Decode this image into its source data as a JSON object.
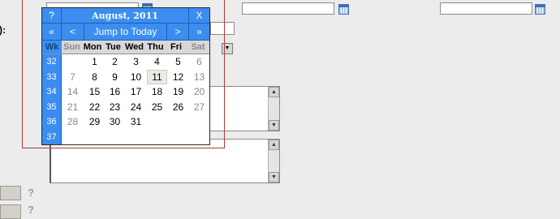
{
  "form": {
    "row_label_fragment": "):"
  },
  "calendar": {
    "help_label": "?",
    "title": "August, 2011",
    "close_label": "X",
    "prev_year_label": "«",
    "prev_month_label": "<",
    "today_label": "Jump to Today",
    "next_month_label": ">",
    "next_year_label": "»",
    "week_header": "Wk",
    "day_names": [
      "Sun",
      "Mon",
      "Tue",
      "Wed",
      "Thu",
      "Fri",
      "Sat"
    ],
    "weeks": [
      {
        "wk": "32",
        "days": [
          "",
          "1",
          "2",
          "3",
          "4",
          "5",
          "6"
        ]
      },
      {
        "wk": "33",
        "days": [
          "7",
          "8",
          "9",
          "10",
          "11",
          "12",
          "13"
        ]
      },
      {
        "wk": "34",
        "days": [
          "14",
          "15",
          "16",
          "17",
          "18",
          "19",
          "20"
        ]
      },
      {
        "wk": "35",
        "days": [
          "21",
          "22",
          "23",
          "24",
          "25",
          "26",
          "27"
        ]
      },
      {
        "wk": "36",
        "days": [
          "28",
          "29",
          "30",
          "31",
          "",
          "",
          ""
        ]
      },
      {
        "wk": "37",
        "days": [
          "",
          "",
          "",
          "",
          "",
          "",
          ""
        ]
      }
    ],
    "today": "11",
    "colors": {
      "header_blue": "#3b8df0",
      "weekend_gray": "#8a8a8a"
    }
  },
  "help_icons": [
    "?",
    "?"
  ],
  "scrollbar_arrows": {
    "up": "▲",
    "down": "▼"
  }
}
